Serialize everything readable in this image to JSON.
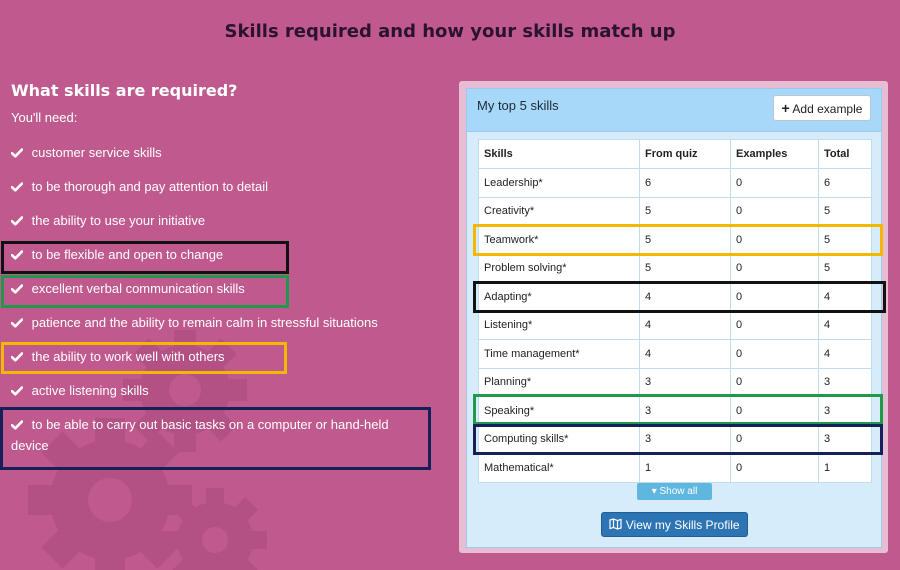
{
  "page_title": "Skills required and how your skills match up",
  "requirements": {
    "heading": "What skills are required?",
    "intro": "You'll need:",
    "items": [
      "customer service skills",
      "to be thorough and pay attention to detail",
      "the ability to use your initiative",
      "to be flexible and open to change",
      "excellent verbal communication skills",
      "patience and the ability to remain calm in stressful situations",
      "the ability to work well with others",
      "active listening skills",
      "to be able to carry out basic tasks on a computer or hand-held device"
    ]
  },
  "panel": {
    "title": "My top 5 skills",
    "add_example_label": "Add example",
    "table": {
      "headers": [
        "Skills",
        "From quiz",
        "Examples",
        "Total"
      ],
      "rows": [
        [
          "Leadership*",
          "6",
          "0",
          "6"
        ],
        [
          "Creativity*",
          "5",
          "0",
          "5"
        ],
        [
          "Teamwork*",
          "5",
          "0",
          "5"
        ],
        [
          "Problem solving*",
          "5",
          "0",
          "5"
        ],
        [
          "Adapting*",
          "4",
          "0",
          "4"
        ],
        [
          "Listening*",
          "4",
          "0",
          "4"
        ],
        [
          "Time management*",
          "4",
          "0",
          "4"
        ],
        [
          "Planning*",
          "3",
          "0",
          "3"
        ],
        [
          "Speaking*",
          "3",
          "0",
          "3"
        ],
        [
          "Computing skills*",
          "3",
          "0",
          "3"
        ],
        [
          "Mathematical*",
          "1",
          "0",
          "1"
        ]
      ]
    },
    "show_all_label": "Show all",
    "profile_button_label": "View my Skills Profile"
  },
  "colors": {
    "background": "#c05a8e",
    "highlight_black": "#111111",
    "highlight_green": "#1f9a4a",
    "highlight_orange": "#f5b800",
    "highlight_navy": "#15205a",
    "primary_button": "#2d74b5"
  },
  "icons": [
    "check-icon",
    "plus-icon",
    "chevron-down-icon",
    "map-icon",
    "gear-icon"
  ]
}
